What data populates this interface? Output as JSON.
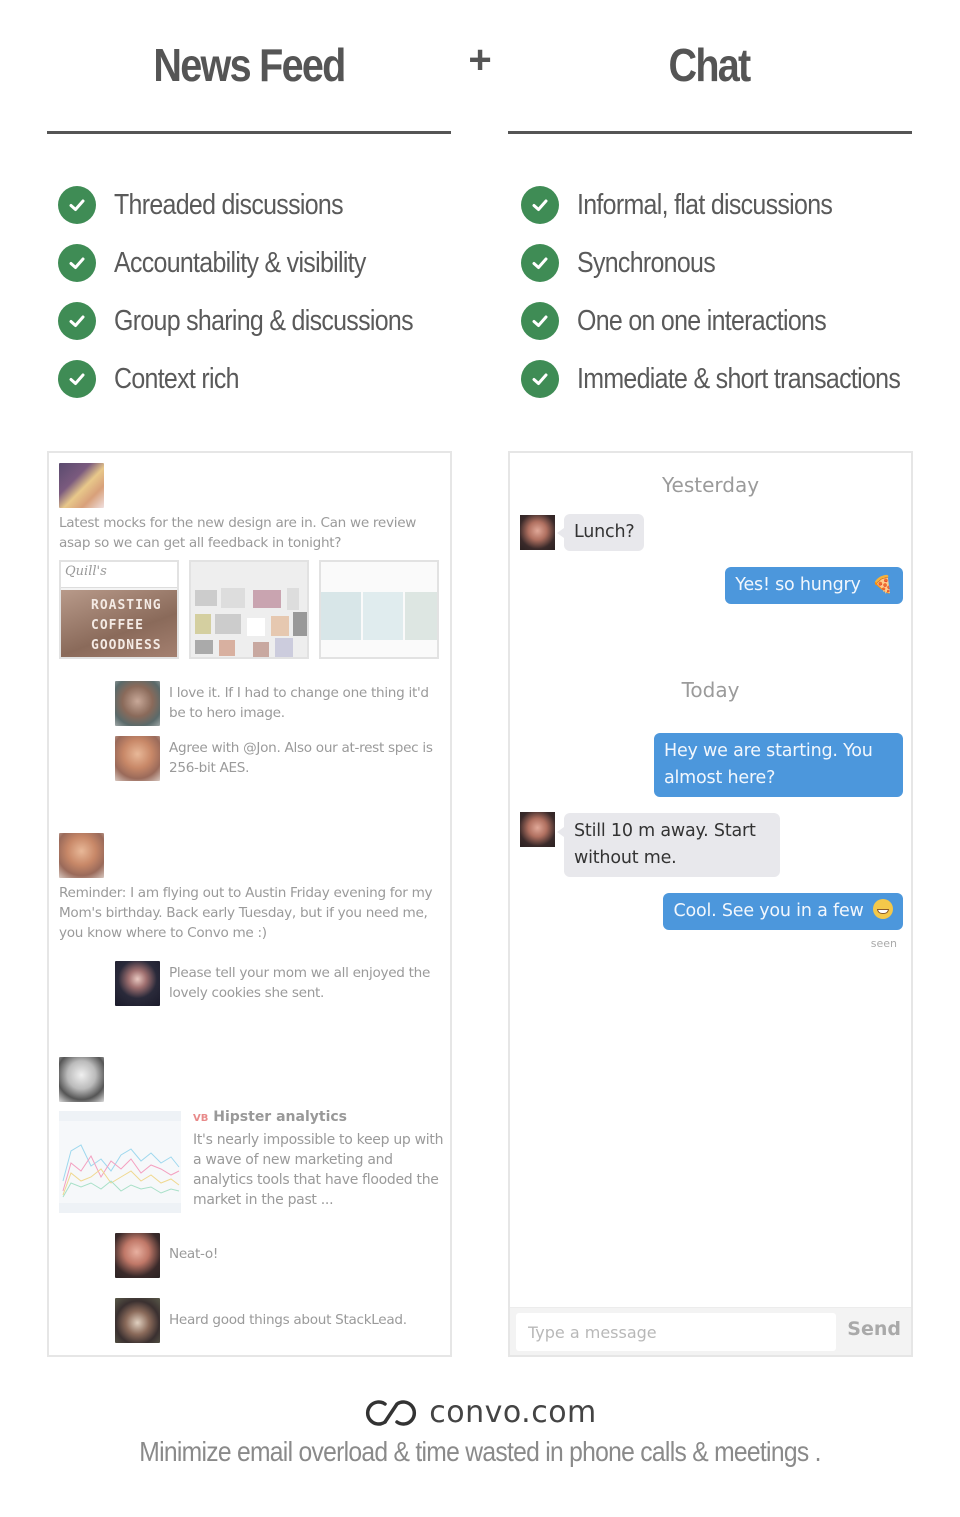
{
  "header": {
    "left_title": "News Feed",
    "plus": "+",
    "right_title": "Chat"
  },
  "features": {
    "news_feed": [
      {
        "icon": "check-circle-icon",
        "label": "Threaded discussions"
      },
      {
        "icon": "check-circle-icon",
        "label": "Accountability & visibility"
      },
      {
        "icon": "check-circle-icon",
        "label": "Group sharing & discussions"
      },
      {
        "icon": "check-circle-icon",
        "label": "Context rich"
      }
    ],
    "chat": [
      {
        "icon": "check-circle-icon",
        "label": "Informal, flat discussions"
      },
      {
        "icon": "check-circle-icon",
        "label": "Synchronous"
      },
      {
        "icon": "check-circle-icon",
        "label": "One on one interactions"
      },
      {
        "icon": "check-circle-icon",
        "label": "Immediate & short transactions"
      }
    ],
    "check_color": "#3f8c55"
  },
  "feed": {
    "posts": [
      {
        "text": "Latest mocks for the new design are in. Can we review asap so we can get all feedback in tonight?",
        "attachments": [
          {
            "label": "ROASTING COFFEE GOODNESS"
          },
          {
            "label": "moodboard"
          },
          {
            "label": "gallery"
          }
        ],
        "comments": [
          {
            "text": "I love it. If I had to change one thing it'd be to hero image."
          },
          {
            "text": "Agree with @Jon. Also our at-rest spec is 256-bit AES."
          }
        ]
      },
      {
        "text": "Reminder: I am flying out to Austin Friday evening for my Mom's birthday. Back early Tuesday, but if you need me, you know where to Convo me :)",
        "comments": [
          {
            "text": "Please tell your mom we all enjoyed the lovely cookies she sent."
          }
        ]
      },
      {
        "link": {
          "source_badge": "VB",
          "title": "Hipster analytics",
          "summary": "It's nearly impossible to keep up with a wave of new marketing and analytics tools that have flooded the market in the past ..."
        },
        "comments": [
          {
            "text": "Neat-o!"
          },
          {
            "text": "Heard good things about StackLead."
          }
        ]
      }
    ]
  },
  "chat": {
    "day_labels": [
      "Yesterday",
      "Today"
    ],
    "messages": [
      {
        "direction": "in",
        "text": "Lunch?"
      },
      {
        "direction": "out",
        "text": "Yes! so hungry",
        "emoji": "pizza"
      },
      {
        "direction": "out",
        "text": "Hey we are starting. You almost here?"
      },
      {
        "direction": "in",
        "text": "Still 10 m away. Start without me."
      },
      {
        "direction": "out",
        "text": "Cool. See you in a few",
        "emoji": "grinning-face"
      }
    ],
    "seen_label": "seen",
    "input_placeholder": "Type a message",
    "send_label": "Send",
    "bubble_out_color": "#4c97dc",
    "bubble_in_color": "#e8e8ec"
  },
  "footer": {
    "brand": "convo.com",
    "tagline": "Minimize email overload & time wasted in phone calls & meetings ."
  }
}
